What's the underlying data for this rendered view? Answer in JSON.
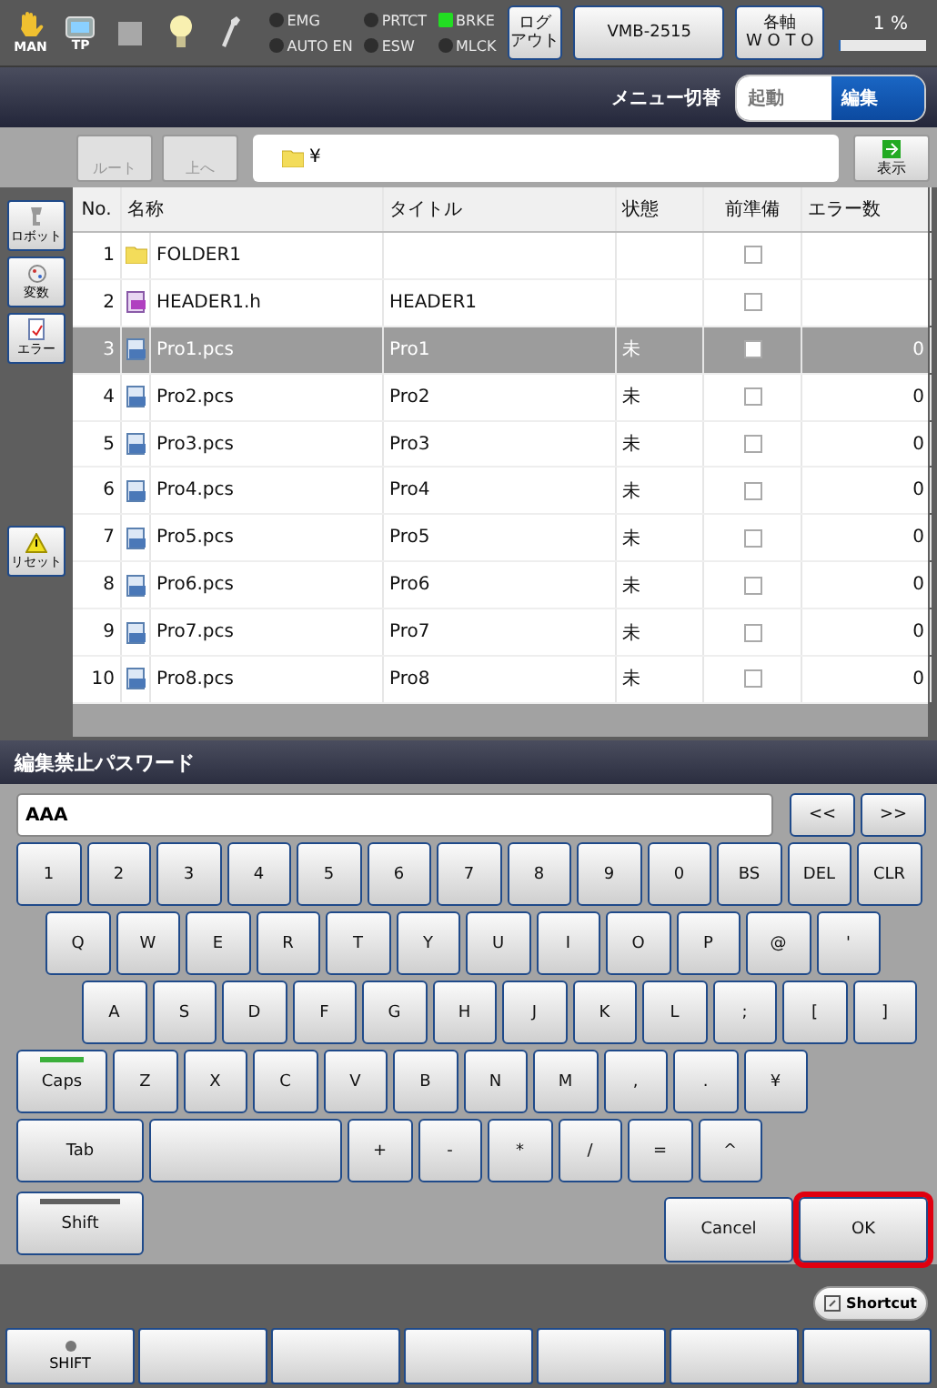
{
  "status_bar": {
    "mode_label": "MAN",
    "pendant_label": "TP",
    "indicators": [
      {
        "label": "EMG",
        "on": false
      },
      {
        "label": "AUTO EN",
        "on": false
      },
      {
        "label": "PRTCT",
        "on": false
      },
      {
        "label": "ESW",
        "on": false
      },
      {
        "label": "BRKE",
        "on": true
      },
      {
        "label": "MLCK",
        "on": false
      }
    ],
    "logout_button": [
      "ログ",
      "アウト"
    ],
    "model_button": "VMB-2515",
    "axis_button": [
      "各軸",
      "W O T O"
    ],
    "speed": {
      "reading": "1 %",
      "level": 0.01
    }
  },
  "menu_bar": {
    "label": "メニュー切替",
    "segments": [
      {
        "label": "起動",
        "selected": false
      },
      {
        "label": "編集",
        "selected": true
      }
    ]
  },
  "toolbar": {
    "buttons": [
      {
        "label": "ルート",
        "disabled": true
      },
      {
        "label": "上へ",
        "disabled": true
      }
    ],
    "path": "¥",
    "show_button": "表示"
  },
  "sidebar": {
    "items": [
      {
        "label": "ロボット",
        "kind": "robot"
      },
      {
        "label": "変数",
        "kind": "variable"
      },
      {
        "label": "エラー",
        "kind": "error"
      }
    ],
    "reset_button": "リセット"
  },
  "table": {
    "columns": [
      "No.",
      "名称",
      "タイトル",
      "状態",
      "前準備",
      "エラー数"
    ],
    "rows": [
      {
        "no": "1",
        "kind": "folder",
        "name": "FOLDER1",
        "selected": false
      },
      {
        "no": "2",
        "kind": "header",
        "name": "HEADER1.h",
        "title": "HEADER1",
        "selected": false
      },
      {
        "no": "3",
        "kind": "program",
        "name": "Pro1.pcs",
        "title": "Pro1",
        "state": "未",
        "errors": "0",
        "selected": true
      },
      {
        "no": "4",
        "kind": "program",
        "name": "Pro2.pcs",
        "title": "Pro2",
        "state": "未",
        "errors": "0",
        "selected": false
      },
      {
        "no": "5",
        "kind": "program",
        "name": "Pro3.pcs",
        "title": "Pro3",
        "state": "未",
        "errors": "0",
        "selected": false
      },
      {
        "no": "6",
        "kind": "program",
        "name": "Pro4.pcs",
        "title": "Pro4",
        "state": "未",
        "errors": "0",
        "selected": false
      },
      {
        "no": "7",
        "kind": "program",
        "name": "Pro5.pcs",
        "title": "Pro5",
        "state": "未",
        "errors": "0",
        "selected": false
      },
      {
        "no": "8",
        "kind": "program",
        "name": "Pro6.pcs",
        "title": "Pro6",
        "state": "未",
        "errors": "0",
        "selected": false
      },
      {
        "no": "9",
        "kind": "program",
        "name": "Pro7.pcs",
        "title": "Pro7",
        "state": "未",
        "errors": "0",
        "selected": false
      },
      {
        "no": "10",
        "kind": "program",
        "name": "Pro8.pcs",
        "title": "Pro8",
        "state": "未",
        "errors": "0",
        "selected": false
      }
    ]
  },
  "keyboard": {
    "title": "編集禁止パスワード",
    "value": "AAA",
    "nav": [
      "<<",
      ">>"
    ],
    "key_rows": [
      {
        "keys": [
          {
            "label": "1"
          },
          {
            "label": "2"
          },
          {
            "label": "3"
          },
          {
            "label": "4"
          },
          {
            "label": "5"
          },
          {
            "label": "6"
          },
          {
            "label": "7"
          },
          {
            "label": "8"
          },
          {
            "label": "9"
          },
          {
            "label": "0"
          },
          {
            "label": "BS"
          },
          {
            "label": "DEL"
          },
          {
            "label": "CLR"
          }
        ]
      },
      {
        "keys": [
          {
            "label": "Q"
          },
          {
            "label": "W"
          },
          {
            "label": "E"
          },
          {
            "label": "R"
          },
          {
            "label": "T"
          },
          {
            "label": "Y"
          },
          {
            "label": "U"
          },
          {
            "label": "I"
          },
          {
            "label": "O"
          },
          {
            "label": "P"
          },
          {
            "label": "@"
          },
          {
            "label": "'"
          }
        ]
      },
      {
        "keys": [
          {
            "label": "A"
          },
          {
            "label": "S"
          },
          {
            "label": "D"
          },
          {
            "label": "F"
          },
          {
            "label": "G"
          },
          {
            "label": "H"
          },
          {
            "label": "J"
          },
          {
            "label": "K"
          },
          {
            "label": "L"
          },
          {
            "label": ";"
          },
          {
            "label": "["
          },
          {
            "label": "]"
          }
        ]
      },
      {
        "keys": [
          {
            "label": "Caps",
            "kind": "toggle",
            "on": true
          },
          {
            "label": "Z"
          },
          {
            "label": "X"
          },
          {
            "label": "C"
          },
          {
            "label": "V"
          },
          {
            "label": "B"
          },
          {
            "label": "N"
          },
          {
            "label": "M"
          },
          {
            "label": ","
          },
          {
            "label": "."
          },
          {
            "label": "¥"
          }
        ]
      },
      {
        "keys": [
          {
            "label": "Tab",
            "kind": "wide"
          },
          {
            "kind": "space"
          },
          {
            "label": "+"
          },
          {
            "label": "-"
          },
          {
            "label": "*"
          },
          {
            "label": "/"
          },
          {
            "label": "="
          },
          {
            "label": "^"
          }
        ]
      }
    ],
    "shift": {
      "label": "Shift",
      "on": false
    },
    "cancel": "Cancel",
    "ok": "OK"
  },
  "shortcut_button": "Shortcut",
  "function_keys": {
    "shift": "SHIFT"
  }
}
